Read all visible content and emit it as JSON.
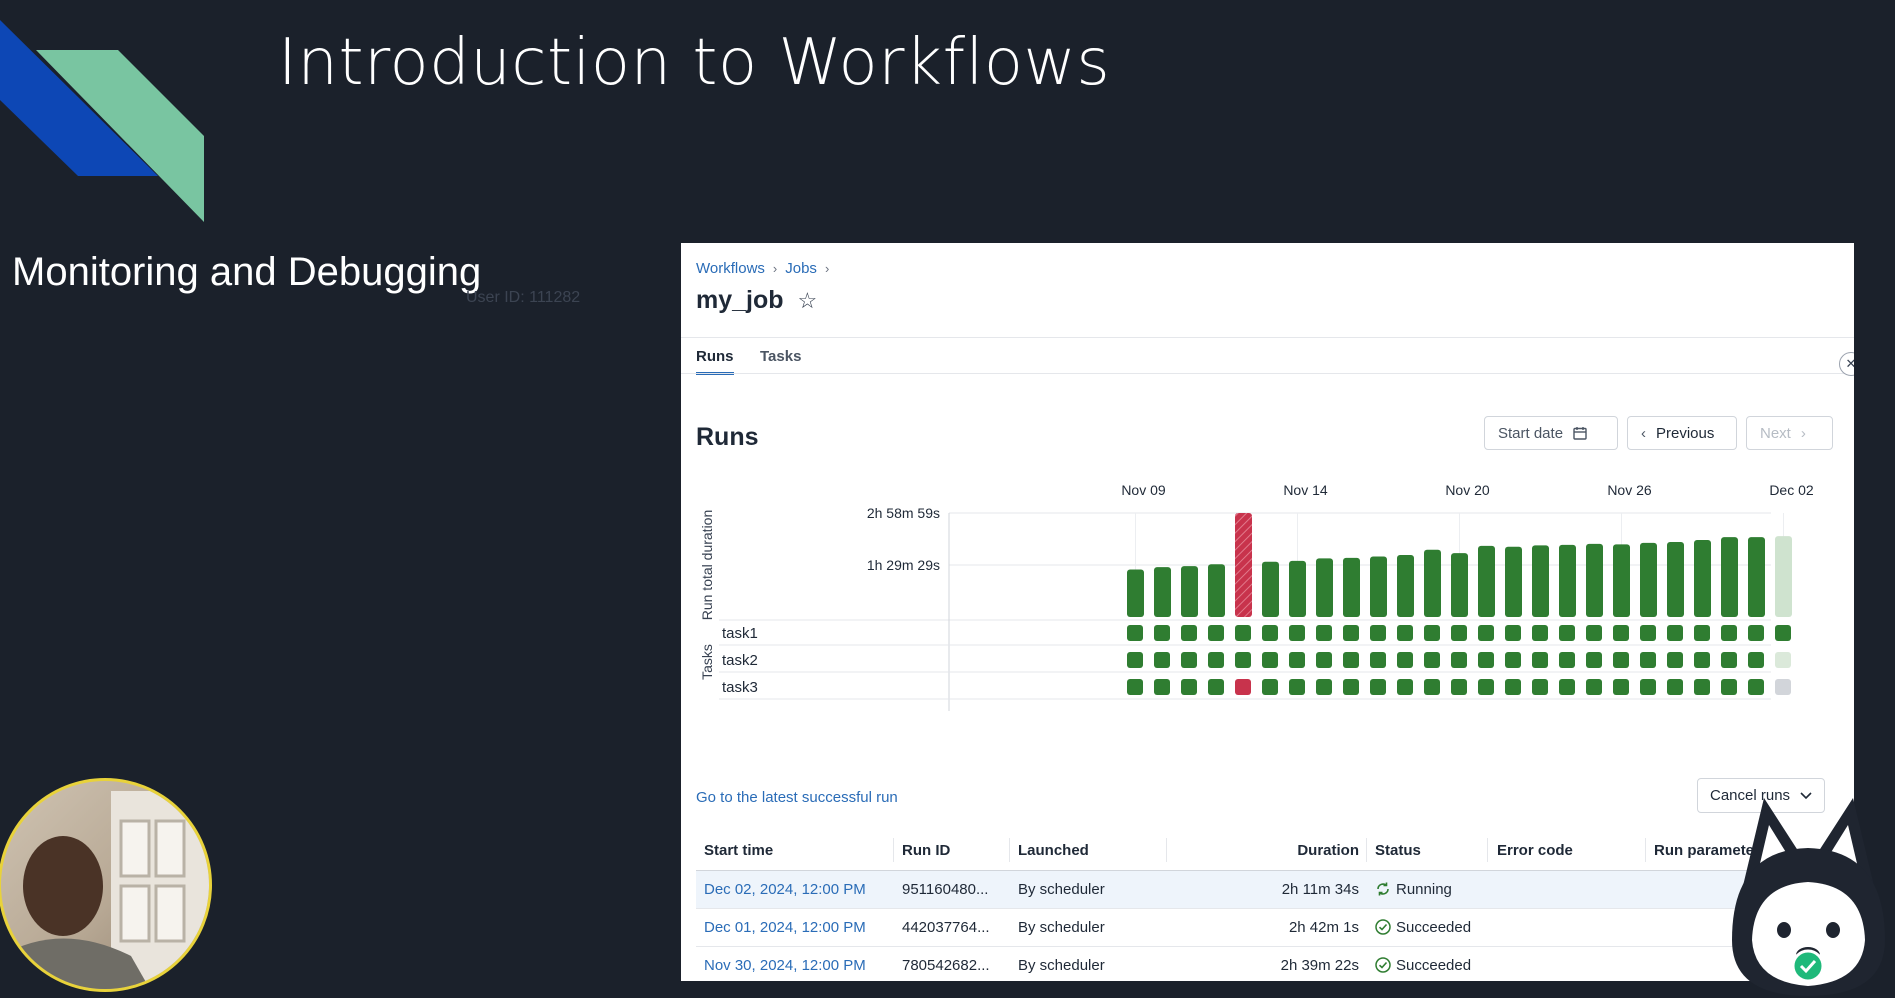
{
  "slide": {
    "title": "Introduction to Workflows",
    "subtitle": "Monitoring and Debugging",
    "watermark": "User ID: 111282"
  },
  "breadcrumb": [
    "Workflows",
    "Jobs"
  ],
  "job": {
    "name": "my_job",
    "star_icon": "star-outline-icon"
  },
  "tabs": [
    {
      "label": "Runs",
      "active": true
    },
    {
      "label": "Tasks",
      "active": false
    }
  ],
  "runs": {
    "heading": "Runs",
    "start_date_label": "Start date",
    "previous_label": "Previous",
    "next_label": "Next"
  },
  "chart_data": {
    "type": "bar",
    "ylabel": "Run total duration",
    "tasks_label": "Tasks",
    "x_ticks": [
      "Nov 09",
      "Nov 14",
      "Nov 20",
      "Nov 26",
      "Dec 02"
    ],
    "y_ticks": [
      "2h 58m 59s",
      "1h 29m 29s"
    ],
    "y_tick_seconds": [
      10739,
      5369
    ],
    "ylim_seconds": [
      0,
      10739
    ],
    "runs_count": 25,
    "durations_seconds": [
      4900,
      5150,
      5250,
      5450,
      10739,
      5700,
      5800,
      6050,
      6100,
      6250,
      6400,
      6950,
      6600,
      7350,
      7250,
      7400,
      7450,
      7550,
      7500,
      7650,
      7750,
      7950,
      8250,
      8250,
      8350
    ],
    "run_status": [
      "succeeded",
      "succeeded",
      "succeeded",
      "succeeded",
      "failed",
      "succeeded",
      "succeeded",
      "succeeded",
      "succeeded",
      "succeeded",
      "succeeded",
      "succeeded",
      "succeeded",
      "succeeded",
      "succeeded",
      "succeeded",
      "succeeded",
      "succeeded",
      "succeeded",
      "succeeded",
      "succeeded",
      "succeeded",
      "succeeded",
      "succeeded",
      "running"
    ],
    "tasks": [
      {
        "name": "task1",
        "status": [
          "s",
          "s",
          "s",
          "s",
          "s",
          "s",
          "s",
          "s",
          "s",
          "s",
          "s",
          "s",
          "s",
          "s",
          "s",
          "s",
          "s",
          "s",
          "s",
          "s",
          "s",
          "s",
          "s",
          "s",
          "s"
        ]
      },
      {
        "name": "task2",
        "status": [
          "s",
          "s",
          "s",
          "s",
          "s",
          "s",
          "s",
          "s",
          "s",
          "s",
          "s",
          "s",
          "s",
          "s",
          "s",
          "s",
          "s",
          "s",
          "s",
          "s",
          "s",
          "s",
          "s",
          "s",
          "p"
        ]
      },
      {
        "name": "task3",
        "status": [
          "s",
          "s",
          "s",
          "s",
          "f",
          "s",
          "s",
          "s",
          "s",
          "s",
          "s",
          "s",
          "s",
          "s",
          "s",
          "s",
          "s",
          "s",
          "s",
          "s",
          "s",
          "s",
          "s",
          "s",
          "q"
        ]
      }
    ],
    "colors": {
      "succeeded": "#2f7d31",
      "failed": "#c8334c",
      "running": "#cfe3cf",
      "pending": "#dbe9da",
      "queued": "#d2d5da"
    }
  },
  "latest_link": "Go to the latest successful run",
  "cancel_runs_label": "Cancel runs",
  "table": {
    "columns": [
      "Start time",
      "Run ID",
      "Launched",
      "Duration",
      "Status",
      "Error code",
      "Run parameters"
    ],
    "rows": [
      {
        "start": "Dec 02, 2024, 12:00 PM",
        "run_id": "951160480...",
        "launched": "By scheduler",
        "duration": "2h 11m 34s",
        "status": "Running"
      },
      {
        "start": "Dec 01, 2024, 12:00 PM",
        "run_id": "442037764...",
        "launched": "By scheduler",
        "duration": "2h 42m 1s",
        "status": "Succeeded"
      },
      {
        "start": "Nov 30, 2024, 12:00 PM",
        "run_id": "780542682...",
        "launched": "By scheduler",
        "duration": "2h 39m 22s",
        "status": "Succeeded"
      }
    ]
  }
}
